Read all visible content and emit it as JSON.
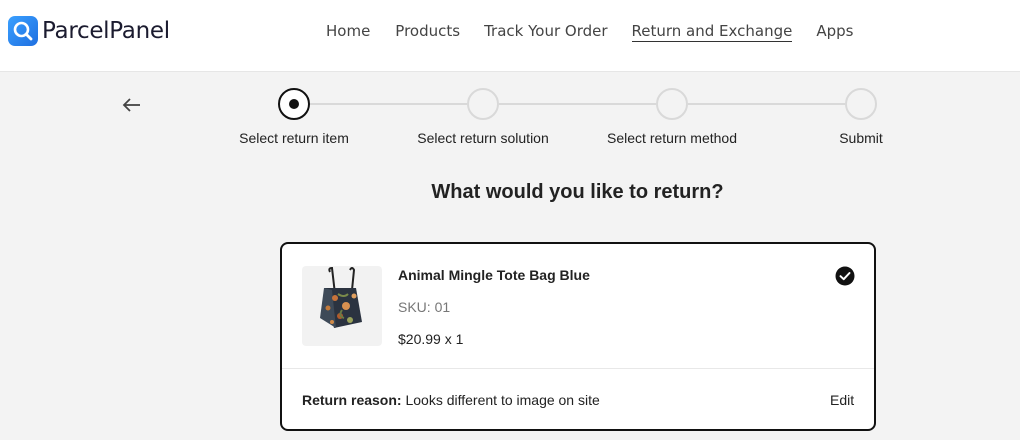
{
  "brand": {
    "name": "ParcelPanel"
  },
  "nav": {
    "items": [
      {
        "label": "Home"
      },
      {
        "label": "Products"
      },
      {
        "label": "Track Your Order"
      },
      {
        "label": "Return and Exchange",
        "active": true
      },
      {
        "label": "Apps"
      }
    ]
  },
  "steps": [
    {
      "label": "Select return item",
      "state": "current"
    },
    {
      "label": "Select return solution",
      "state": "upcoming"
    },
    {
      "label": "Select return method",
      "state": "upcoming"
    },
    {
      "label": "Submit",
      "state": "upcoming"
    }
  ],
  "page": {
    "title": "What would you like to return?"
  },
  "item": {
    "name": "Animal Mingle Tote Bag Blue",
    "sku": "SKU: 01",
    "price": "$20.99 x 1",
    "selected": true,
    "reason_label": "Return reason:",
    "reason_value": "Looks different to image on site",
    "edit_label": "Edit"
  },
  "colors": {
    "brand": "#1f6fe0",
    "accent": "#111111",
    "background": "#f3f3f3"
  }
}
